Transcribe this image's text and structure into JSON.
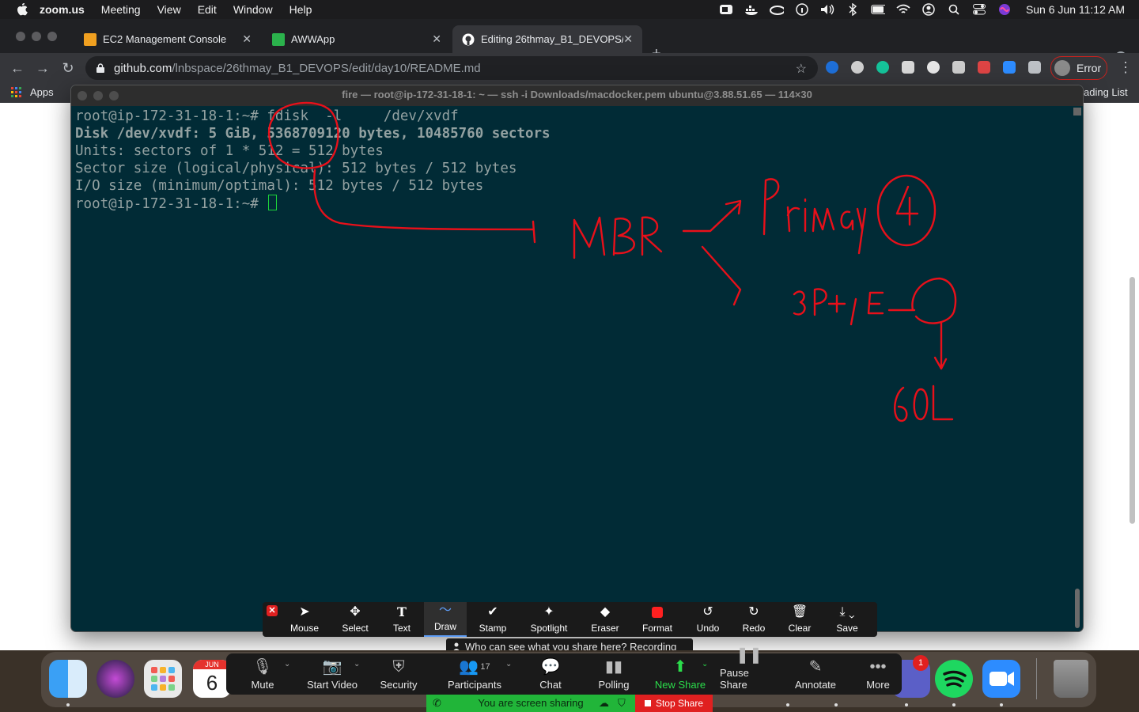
{
  "menubar": {
    "app_name": "zoom.us",
    "menus": [
      "Meeting",
      "View",
      "Edit",
      "Window",
      "Help"
    ],
    "clock": "Sun 6 Jun  11:12 AM",
    "status_icons": [
      "zoom-icon",
      "docker-icon",
      "cloud-icon",
      "info-icon",
      "volume-icon",
      "bluetooth-icon",
      "battery-icon",
      "wifi-icon",
      "user-icon",
      "search-icon",
      "control-center-icon",
      "siri-icon"
    ]
  },
  "browser": {
    "tabs": [
      {
        "title": "EC2 Management Console",
        "icon": "aws-icon",
        "color": "#f0a020"
      },
      {
        "title": "AWWApp",
        "icon": "awwapp-icon",
        "color": "#2bb24c"
      },
      {
        "title": "Editing 26thmay_B1_DEVOPS/",
        "icon": "github-icon",
        "color": "#ffffff"
      }
    ],
    "url_host": "github.com",
    "url_path": "/lnbspace/26thmay_B1_DEVOPS/edit/day10/README.md",
    "profile_label": "Error",
    "bookmarks": {
      "apps": "Apps",
      "reading_list": "ading List"
    }
  },
  "terminal": {
    "title": "fire — root@ip-172-31-18-1: ~ — ssh -i Downloads/macdocker.pem ubuntu@3.88.51.65 — 114×30",
    "lines": [
      "root@ip-172-31-18-1:~# fdisk  -l     /dev/xvdf",
      "Disk /dev/xvdf: 5 GiB, 5368709120 bytes, 10485760 sectors",
      "Units: sectors of 1 * 512 = 512 bytes",
      "Sector size (logical/physical): 512 bytes / 512 bytes",
      "I/O size (minimum/optimal): 512 bytes / 512 bytes",
      "root@ip-172-31-18-1:~# "
    ]
  },
  "annotation_toolbar": {
    "tools": [
      "Mouse",
      "Select",
      "Text",
      "Draw",
      "Stamp",
      "Spotlight",
      "Eraser",
      "Format",
      "Undo",
      "Redo",
      "Clear",
      "Save"
    ],
    "selected": "Draw",
    "format_color": "#ff2020"
  },
  "share_notice": "Who can see what you share here? Recording On",
  "zoom_controls": {
    "buttons": [
      "Mute",
      "Start Video",
      "Security",
      "Participants",
      "Chat",
      "Polling",
      "New Share",
      "Pause Share",
      "Annotate",
      "More"
    ],
    "participants_count": "17",
    "sharing_status": "You are screen sharing",
    "stop_share": "Stop Share"
  },
  "dock": {
    "apps": [
      "finder-icon",
      "siri-icon",
      "launchpad-icon",
      "calendar-icon",
      "teams-icon",
      "spotify-icon",
      "zoom-icon",
      "trash-icon"
    ],
    "calendar_month": "JUN",
    "calendar_day": "6",
    "badge": "1"
  },
  "ink_color": "#e8101a"
}
